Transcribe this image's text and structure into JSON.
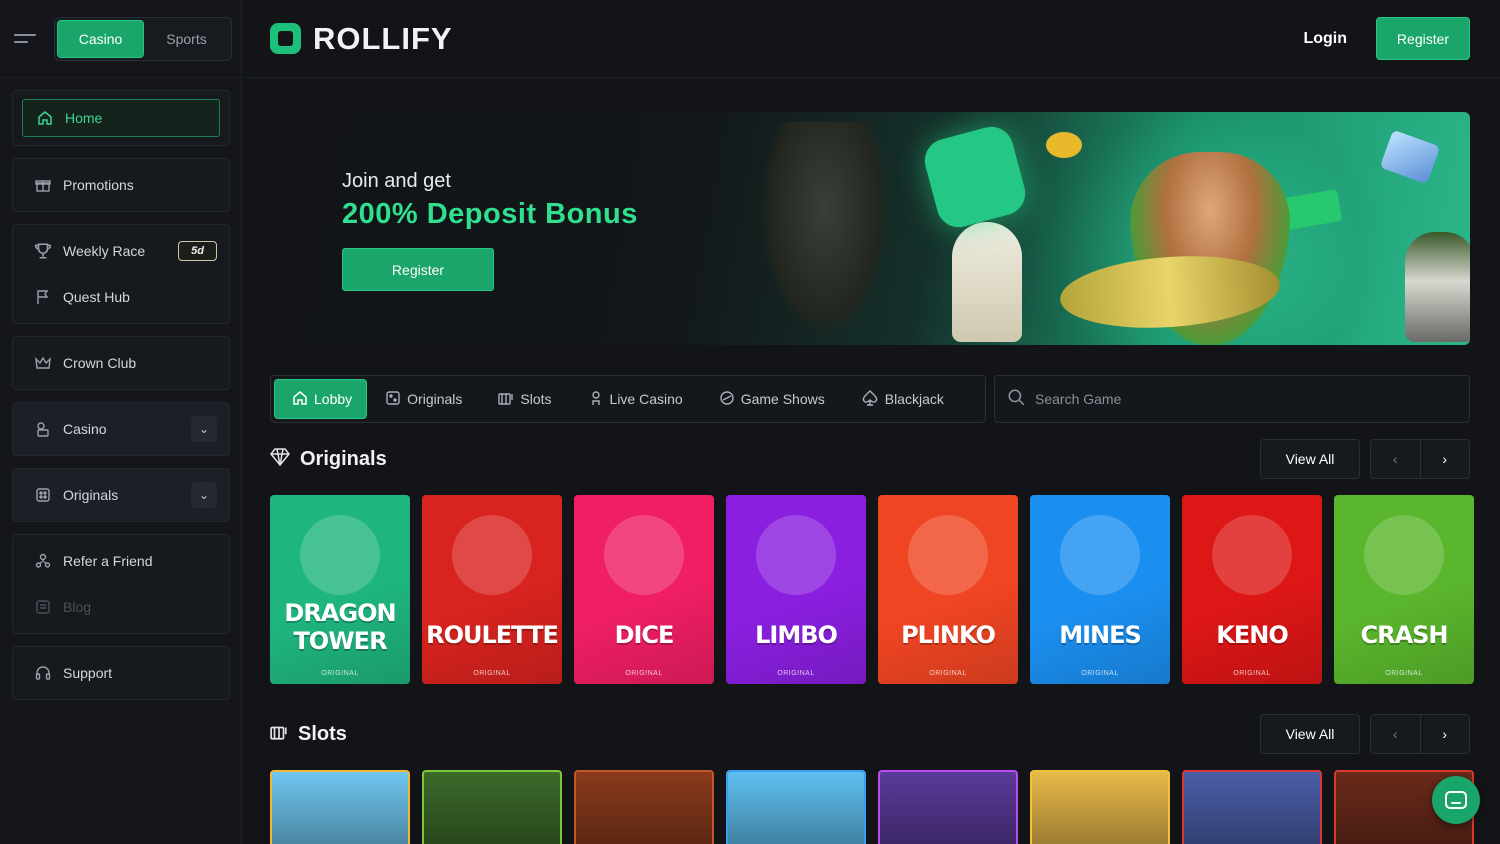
{
  "header": {
    "mode_tabs": [
      "Casino",
      "Sports"
    ],
    "brand": "ROLLIFY",
    "login": "Login",
    "register": "Register"
  },
  "sidebar": {
    "items": [
      {
        "label": "Home",
        "icon": "home-icon"
      },
      {
        "label": "Promotions",
        "icon": "gift-icon"
      },
      {
        "label": "Weekly Race",
        "icon": "trophy-icon",
        "badge": "5d"
      },
      {
        "label": "Quest Hub",
        "icon": "flag-icon"
      },
      {
        "label": "Crown Club",
        "icon": "crown-icon"
      },
      {
        "label": "Casino",
        "icon": "cards-icon"
      },
      {
        "label": "Originals",
        "icon": "dice-icon"
      },
      {
        "label": "Refer a Friend",
        "icon": "people-icon"
      },
      {
        "label": "Blog",
        "icon": "blog-icon"
      },
      {
        "label": "Support",
        "icon": "headset-icon"
      }
    ]
  },
  "banner": {
    "subtitle": "Join and get",
    "title": "200% Deposit Bonus",
    "button": "Register"
  },
  "tabs": [
    {
      "label": "Lobby",
      "icon": "home-icon"
    },
    {
      "label": "Originals",
      "icon": "dice-icon"
    },
    {
      "label": "Slots",
      "icon": "slots-icon"
    },
    {
      "label": "Live Casino",
      "icon": "dealer-icon"
    },
    {
      "label": "Game Shows",
      "icon": "show-icon"
    },
    {
      "label": "Blackjack",
      "icon": "spade-icon"
    }
  ],
  "search": {
    "placeholder": "Search Game"
  },
  "originals": {
    "title": "Originals",
    "view_all": "View All",
    "games": [
      {
        "line1": "DRAGON",
        "line2": "TOWER",
        "tag": "ORIGINAL",
        "color": "#1fb57e"
      },
      {
        "line1": "ROULETTE",
        "line2": "",
        "tag": "ORIGINAL",
        "color": "#d8231f"
      },
      {
        "line1": "DICE",
        "line2": "",
        "tag": "ORIGINAL",
        "color": "#f01e63"
      },
      {
        "line1": "LIMBO",
        "line2": "",
        "tag": "ORIGINAL",
        "color": "#8a1fe0"
      },
      {
        "line1": "PLINKO",
        "line2": "",
        "tag": "ORIGINAL",
        "color": "#f04523"
      },
      {
        "line1": "MINES",
        "line2": "",
        "tag": "ORIGINAL",
        "color": "#1b8ff0"
      },
      {
        "line1": "KENO",
        "line2": "",
        "tag": "ORIGINAL",
        "color": "#dd1616"
      },
      {
        "line1": "CRASH",
        "line2": "",
        "tag": "ORIGINAL",
        "color": "#5ab62c"
      }
    ]
  },
  "slots": {
    "title": "Slots",
    "view_all": "View All",
    "tiles": [
      {
        "border": "#f0b93a",
        "bg": "#6fc6f0"
      },
      {
        "border": "#7cc63a",
        "bg": "#3c6a2a"
      },
      {
        "border": "#c4562a",
        "bg": "#8a3a1c"
      },
      {
        "border": "#3aa0f0",
        "bg": "#5fc0f0"
      },
      {
        "border": "#b84af0",
        "bg": "#5a3a9a"
      },
      {
        "border": "#f0c23a",
        "bg": "#e8b94a"
      },
      {
        "border": "#d83a3a",
        "bg": "#4a5ea8"
      },
      {
        "border": "#d83a2a",
        "bg": "#6a2a1a"
      }
    ]
  },
  "colors": {
    "accent": "#1aa56b",
    "bg": "#121418"
  }
}
